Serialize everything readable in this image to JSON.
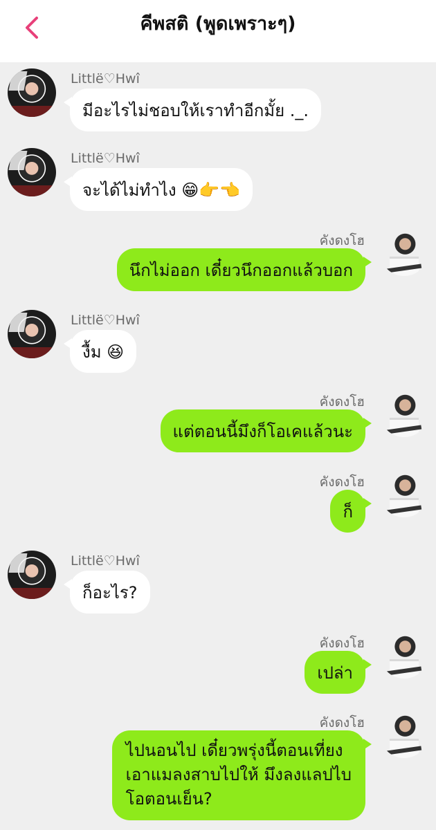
{
  "header": {
    "title": "คีพสติ (พูดเพราะๆ)",
    "back_icon": "chevron-left-icon",
    "accent_color": "#e8407a"
  },
  "colors": {
    "background": "#efefef",
    "incoming_bubble": "#ffffff",
    "outgoing_bubble": "#8eea1b"
  },
  "contacts": {
    "other": "Littlë♡Hwî",
    "me": "คังดงโฮ"
  },
  "messages": [
    {
      "side": "left",
      "sender": "Littlë♡Hwî",
      "text": "มีอะไรไม่ชอบให้เราทำอีกมั้ย ._."
    },
    {
      "side": "left",
      "sender": "Littlë♡Hwî",
      "text": "จะได้ไม่ทำไง 😁👉👈"
    },
    {
      "side": "right",
      "sender": "คังดงโฮ",
      "text": "นึกไม่ออก เดี๋ยวนึกออกแล้วบอก"
    },
    {
      "side": "left",
      "sender": "Littlë♡Hwî",
      "text": "งื้ม 😆"
    },
    {
      "side": "right",
      "sender": "คังดงโฮ",
      "text": "แต่ตอนนี้มึงก็โอเคแล้วนะ"
    },
    {
      "side": "right",
      "sender": "คังดงโฮ",
      "text": "ก็"
    },
    {
      "side": "left",
      "sender": "Littlë♡Hwî",
      "text": "ก็อะไร?"
    },
    {
      "side": "right",
      "sender": "คังดงโฮ",
      "text": "เปล่า"
    },
    {
      "side": "right",
      "sender": "คังดงโฮ",
      "lines": [
        "ไปนอนไป เดี๋ยวพรุ่งนี้ตอนเที่ยง",
        "เอาแมลงสาบไปให้ มึงลงแลปไบ",
        "โอตอนเย็น?"
      ]
    }
  ]
}
